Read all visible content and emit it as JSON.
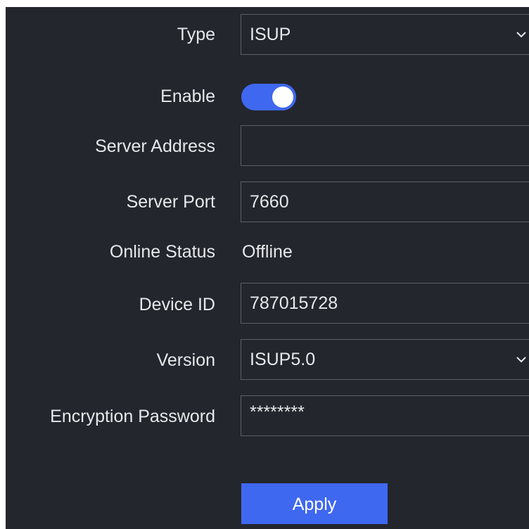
{
  "form": {
    "type": {
      "label": "Type",
      "value": "ISUP"
    },
    "enable": {
      "label": "Enable",
      "state": "on"
    },
    "server_address": {
      "label": "Server Address",
      "value": ""
    },
    "server_port": {
      "label": "Server Port",
      "value": "7660"
    },
    "online_status": {
      "label": "Online Status",
      "value": "Offline"
    },
    "device_id": {
      "label": "Device ID",
      "value": "787015728"
    },
    "version": {
      "label": "Version",
      "value": "ISUP5.0"
    },
    "encryption_password": {
      "label": "Encryption Password",
      "value": "********"
    },
    "apply_label": "Apply"
  },
  "colors": {
    "background": "#23262d",
    "accent": "#3f68f0",
    "text": "#e6e8ea",
    "border": "#5a5f68"
  },
  "icons": {
    "dropdown": "chevron-down-icon"
  }
}
